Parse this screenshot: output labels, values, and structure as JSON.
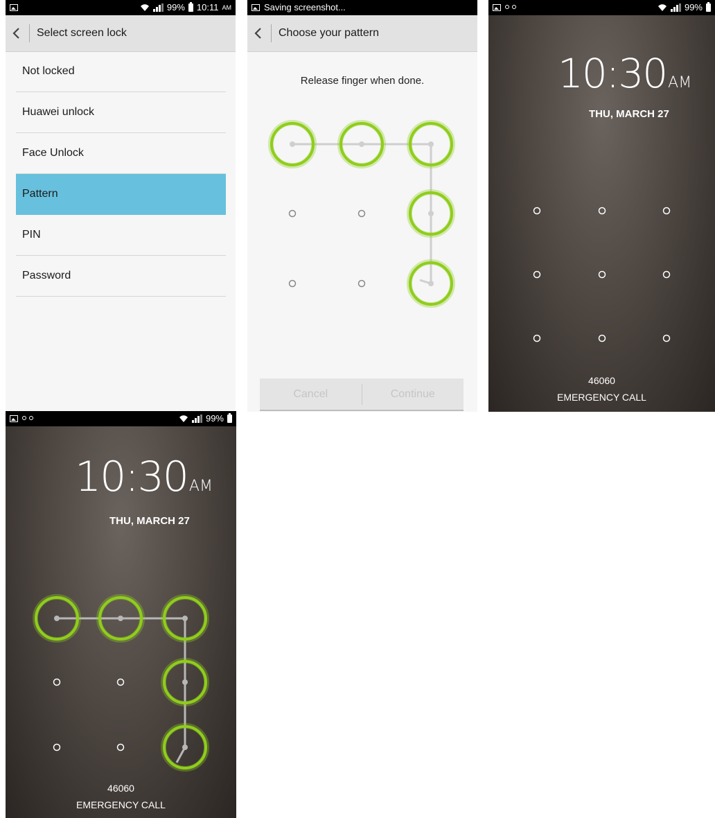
{
  "screen1": {
    "status_time": "10:11",
    "status_ampm": "AM",
    "battery": "99%",
    "title": "Select screen lock",
    "options": [
      {
        "label": "Not locked",
        "selected": false
      },
      {
        "label": "Huawei unlock",
        "selected": false
      },
      {
        "label": "Face Unlock",
        "selected": false
      },
      {
        "label": "Pattern",
        "selected": true
      },
      {
        "label": "PIN",
        "selected": false
      },
      {
        "label": "Password",
        "selected": false
      }
    ]
  },
  "screen2": {
    "status_text": "Saving screenshot...",
    "title": "Choose your pattern",
    "instruction": "Release finger when done.",
    "cancel_label": "Cancel",
    "continue_label": "Continue"
  },
  "screen3": {
    "battery": "99%",
    "clock": "10:30",
    "ampm": "AM",
    "date": "THU, MARCH 27",
    "carrier": "46060",
    "emergency": "EMERGENCY CALL"
  },
  "screen4": {
    "battery": "99%",
    "clock": "10:30",
    "ampm": "AM",
    "date": "THU, MARCH 27",
    "carrier": "46060",
    "emergency": "EMERGENCY CALL"
  },
  "pattern_sequence": [
    1,
    2,
    3,
    6,
    9
  ],
  "colors": {
    "selected_item": "#67c0dd",
    "pattern_ring": "#8fcd1c",
    "title_bar": "#e2e2e2"
  }
}
